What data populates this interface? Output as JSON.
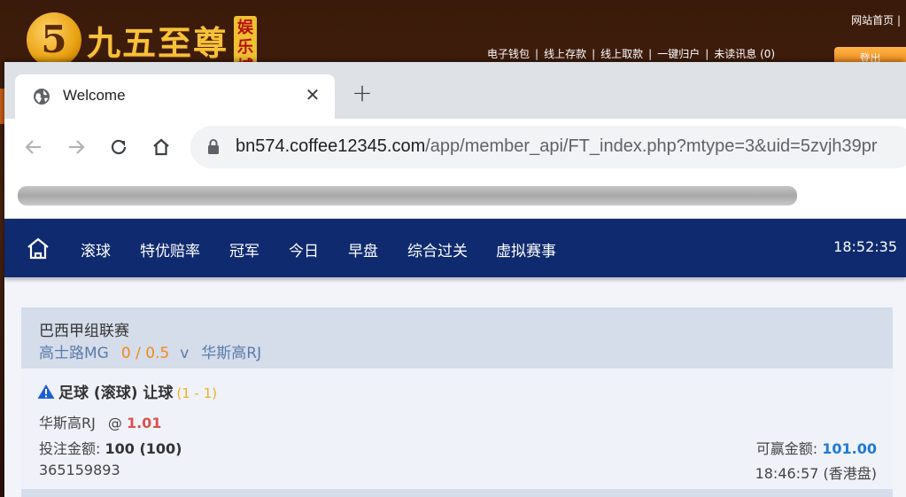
{
  "background_site": {
    "logo_digit": "5",
    "logo_text": "九五至尊",
    "logo_tag": "娱乐城",
    "home_link": "网站首页 |",
    "nav": [
      "电子钱包",
      "线上存款",
      "线上取款",
      "一键归户",
      "未读讯息 (0)"
    ],
    "logout_label": "登出"
  },
  "browser": {
    "tab_title": "Welcome",
    "tab_close": "✕",
    "new_tab": "+",
    "url_host": "bn574.coffee12345.com",
    "url_path": "/app/member_api/FT_index.php?mtype=3&uid=5zvjh39pr"
  },
  "site": {
    "nav": [
      "滚球",
      "特优赔率",
      "冠军",
      "今日",
      "早盘",
      "综合过关",
      "虚拟赛事"
    ],
    "clock": "18:52:35"
  },
  "bet": {
    "league": "巴西甲组联赛",
    "home_team": "高士路MG",
    "handicap": "0 / 0.5",
    "vs": "v",
    "away_team": "华斯高RJ",
    "title": "足球 (滚球) 让球",
    "score": "(1 - 1)",
    "pick": "华斯高RJ",
    "at": "@",
    "odds": "1.01",
    "stake_label": "投注金额:",
    "stake_value": "100 (100)",
    "win_label": "可赢金额:",
    "win_value": "101.00",
    "ticket_id": "365159893",
    "time": "18:46:57 (香港盘)"
  },
  "colors": {
    "site_nav_bg": "#0f2a6e",
    "handicap": "#f08a1a",
    "odds": "#d9534f",
    "win_value": "#1d7ad6",
    "score": "#f0b020"
  }
}
